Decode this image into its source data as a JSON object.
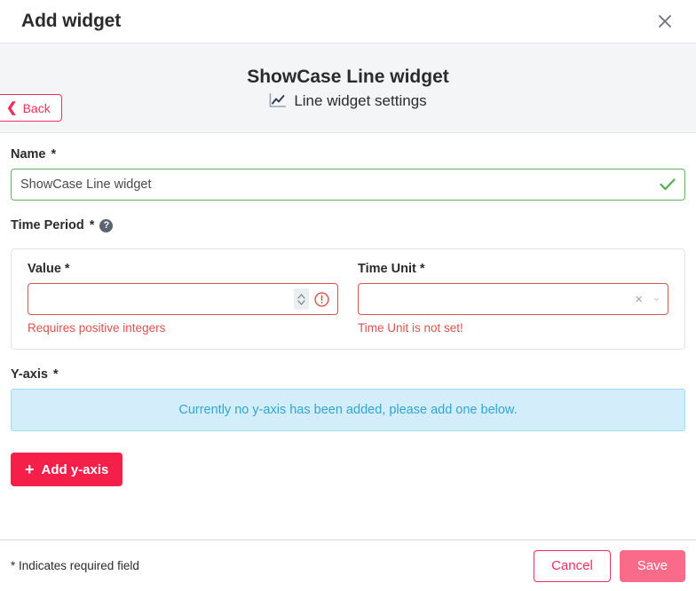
{
  "modal": {
    "title": "Add widget",
    "close_icon": "close-icon"
  },
  "subheader": {
    "back_label": "Back",
    "back_icon": "chevron-left-icon",
    "widget_title": "ShowCase Line widget",
    "widget_subtitle": "Line widget settings",
    "subtitle_icon": "line-chart-icon"
  },
  "name_field": {
    "label": "Name",
    "required_mark": "*",
    "value": "ShowCase Line widget",
    "placeholder": "",
    "validation_icon": "check-icon",
    "state": "valid"
  },
  "time_period": {
    "label": "Time Period",
    "required_mark": "*",
    "help_icon": "question-mark-icon",
    "help_glyph": "?",
    "value_field": {
      "label": "Value",
      "required_mark": "*",
      "value": "",
      "placeholder": "",
      "error": "Requires positive integers",
      "stepper_icon": "spinner-updown-icon",
      "error_icon": "exclamation-circle-icon",
      "state": "error"
    },
    "time_unit_field": {
      "label": "Time Unit",
      "required_mark": "*",
      "value": "",
      "placeholder": "",
      "error": "Time Unit is not set!",
      "clear_icon": "clear-x-icon",
      "clear_glyph": "×",
      "caret_icon": "chevron-down-icon",
      "state": "error"
    }
  },
  "yaxis": {
    "label": "Y-axis",
    "required_mark": "*",
    "info_message": "Currently no y-axis has been added, please add one below.",
    "add_button": "Add y-axis",
    "add_icon": "plus-icon",
    "add_glyph": "+"
  },
  "footer": {
    "required_note": "* Indicates required field",
    "cancel_label": "Cancel",
    "save_label": "Save",
    "save_state": "disabled"
  },
  "colors": {
    "brand_pink": "#f5204a",
    "brand_pink_outline": "#ef2e5b",
    "save_disabled": "#fa6b8a",
    "error_red": "#d9534f",
    "valid_green": "#5cb85c",
    "info_bg": "#d3eefa",
    "info_text": "#31a5d4",
    "header_band": "#f4f5f7"
  }
}
